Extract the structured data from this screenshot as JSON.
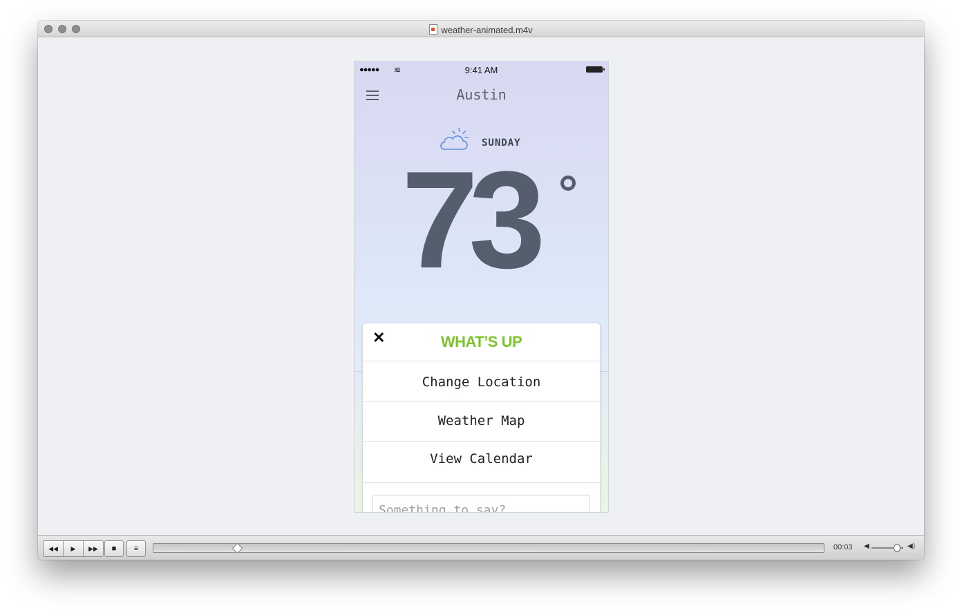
{
  "window": {
    "title": "weather-animated.m4v"
  },
  "phone": {
    "status": {
      "signal": "●●●●●",
      "wifi": "≋",
      "time": "9:41 AM"
    },
    "city": "Austin",
    "day": "SUNDAY",
    "temperature": "73",
    "weather_icon": "partly-cloudy-icon",
    "panel": {
      "title": "WHAT’S UP",
      "close": "✕",
      "items": [
        "Change Location",
        "Weather Map",
        "View Calendar"
      ],
      "input_placeholder": "Something to say?"
    }
  },
  "controls": {
    "rewind": "◀◀",
    "play": "▶",
    "forward": "▶▶",
    "stop": "■",
    "chapters": "≡",
    "time": "00:03",
    "progress_fraction": 0.12,
    "volume_fraction": 0.8
  },
  "colors": {
    "accent_green": "#7cc42b",
    "temp_gray": "#555e6d"
  }
}
